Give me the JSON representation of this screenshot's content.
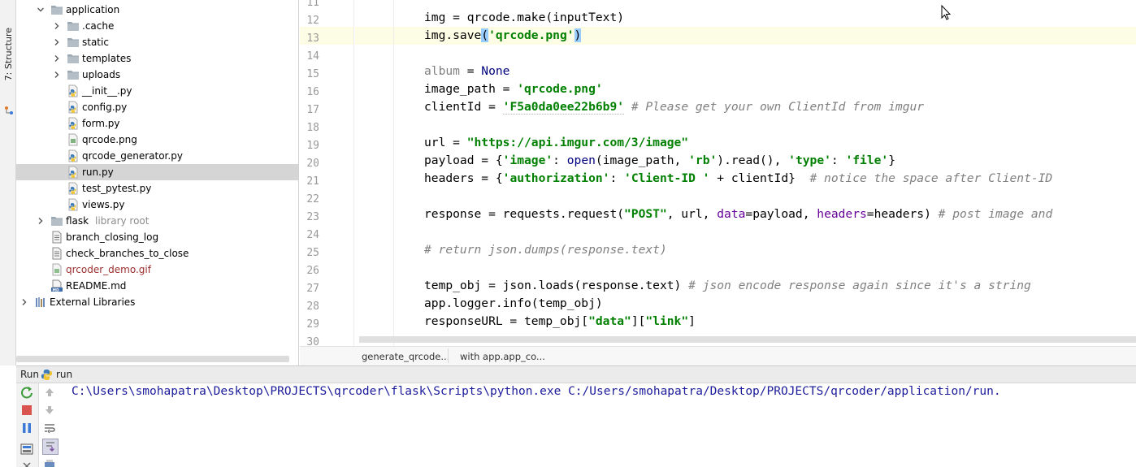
{
  "tool_strip": {
    "structure_tab_label": "7: Structure"
  },
  "project_tree": {
    "items": [
      {
        "label": "application",
        "kind": "folder",
        "expanded": true
      },
      {
        "label": ".cache",
        "kind": "folder"
      },
      {
        "label": "static",
        "kind": "folder"
      },
      {
        "label": "templates",
        "kind": "folder"
      },
      {
        "label": "uploads",
        "kind": "folder"
      },
      {
        "label": "__init__.py",
        "kind": "python-file"
      },
      {
        "label": "config.py",
        "kind": "python-file"
      },
      {
        "label": "form.py",
        "kind": "python-file"
      },
      {
        "label": "qrcode.png",
        "kind": "image-file"
      },
      {
        "label": "qrcode_generator.py",
        "kind": "python-file"
      },
      {
        "label": "run.py",
        "kind": "python-file",
        "selected": true
      },
      {
        "label": "test_pytest.py",
        "kind": "python-file"
      },
      {
        "label": "views.py",
        "kind": "python-file"
      },
      {
        "label": "flask",
        "kind": "folder",
        "sublabel": "library root"
      },
      {
        "label": "branch_closing_log",
        "kind": "text-file"
      },
      {
        "label": "check_branches_to_close",
        "kind": "text-file"
      },
      {
        "label": "qrcoder_demo.gif",
        "kind": "gif-file"
      },
      {
        "label": "README.md",
        "kind": "markdown-file"
      },
      {
        "label": "External Libraries",
        "kind": "libraries"
      }
    ]
  },
  "editor": {
    "line_numbers": [
      "11",
      "12",
      "13",
      "14",
      "15",
      "16",
      "17",
      "18",
      "19",
      "20",
      "21",
      "22",
      "23",
      "24",
      "25",
      "26",
      "27",
      "28",
      "29",
      "30"
    ],
    "lines": {
      "l12": {
        "a": "img = qrcode.make(inputText)"
      },
      "l13": {
        "a": "img.save",
        "b": "(",
        "c": "'qrcode.png'",
        "d": ")"
      },
      "l15": {
        "a": "album",
        "b": " = ",
        "c": "None"
      },
      "l16": {
        "a": "image_path = ",
        "b": "'qrcode.png'"
      },
      "l17": {
        "a": "clientId = ",
        "b": "'F5a0da0ee22b6b9'",
        "c": " # Please get your own ClientId from imgur"
      },
      "l19": {
        "a": "url = ",
        "b": "\"https://api.imgur.com/3/image\""
      },
      "l20": {
        "a": "payload = {",
        "b": "'image'",
        "c": ": ",
        "d": "open",
        "e": "(image_path, ",
        "f": "'rb'",
        "g": ").read(), ",
        "h": "'type'",
        "i": ": ",
        "j": "'file'",
        "k": "}"
      },
      "l21": {
        "a": "headers = {",
        "b": "'authorization'",
        "c": ": ",
        "d": "'Client-ID '",
        "e": " + clientId}  ",
        "f": "# notice the space after Client-ID"
      },
      "l23": {
        "a": "response = requests.request(",
        "b": "\"POST\"",
        "c": ", url, ",
        "d": "data",
        "e": "=payload, ",
        "f": "headers",
        "g": "=headers) ",
        "h": "# post image and"
      },
      "l25": {
        "a": "# return json.dumps(response.text)"
      },
      "l27": {
        "a": "temp_obj = json.loads(response.text) ",
        "b": "# json encode response again since it's a string"
      },
      "l28": {
        "a": "app.logger.info(temp_obj)"
      },
      "l29": {
        "a": "responseURL = temp_obj[",
        "b": "\"data\"",
        "c": "][",
        "d": "\"link\"",
        "e": "]"
      }
    }
  },
  "breadcrumbs": [
    "generate_qrcode...",
    "with app.app_co..."
  ],
  "run_panel": {
    "title": "Run",
    "config_name": "run",
    "console_line": "C:\\Users\\smohapatra\\Desktop\\PROJECTS\\qrcoder\\flask\\Scripts\\python.exe C:/Users/smohapatra/Desktop/PROJECTS/qrcoder/application/run."
  },
  "colors": {
    "keyword": "#000080",
    "string": "#008000",
    "comment": "#808080",
    "param": "#660099",
    "console_text": "#1c1c9c",
    "selection": "#d5d5d5",
    "current_line": "#fdfce4"
  }
}
